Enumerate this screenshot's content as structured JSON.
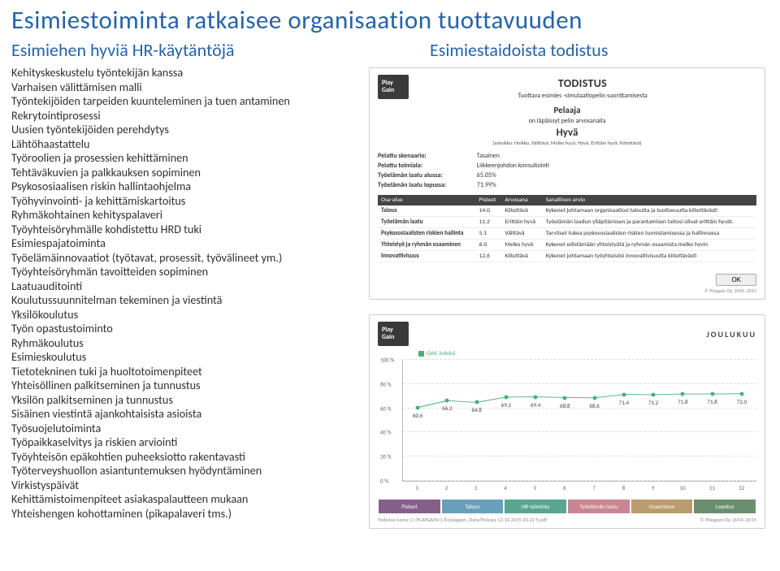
{
  "title": "Esimiestoiminta ratkaisee organisaation tuottavuuden",
  "left_heading": "Esimiehen hyviä HR-käytäntöjä",
  "right_heading": "Esimiestaidoista todistus",
  "practices": [
    "Kehityskeskustelu työntekijän kanssa",
    "Varhaisen välittämisen malli",
    "Työntekijöiden tarpeiden kuunteleminen ja tuen antaminen",
    "Rekrytointiprosessi",
    "Uusien työntekijöiden perehdytys",
    "Lähtöhaastattelu",
    "Työroolien ja prosessien kehittäminen",
    "Tehtäväkuvien ja palkkauksen sopiminen",
    "Psykososiaalisen riskin hallintaohjelma",
    "Työhyvinvointi- ja kehittämiskartoitus",
    "Ryhmäkohtainen kehityspalaveri",
    "Työyhteisöryhmälle kohdistettu HRD tuki",
    "Esimiespajatoiminta",
    "Työelämäinnovaatiot (työtavat, prosessit, työvälineet ym.)",
    "Työyhteisöryhmän tavoitteiden sopiminen",
    "Laatuauditointi",
    "Koulutussuunnitelman tekeminen ja viestintä",
    "Yksilökoulutus",
    "Työn opastustoiminto",
    "Ryhmäkoulutus",
    "Esimieskoulutus",
    "Tietotekninen tuki ja huoltotoimenpiteet",
    "Yhteisöllinen palkitseminen ja tunnustus",
    "Yksilön palkitseminen ja tunnustus",
    "Sisäinen viestintä ajankohtaisista asioista",
    "Työsuojelutoiminta",
    "Työpaikkaselvitys ja riskien arviointi",
    "Työyhteisön epäkohtien puheeksiotto rakentavasti",
    "Työterveyshuollon asiantuntemuksen hyödyntäminen",
    "Virkistyspäivät",
    "Kehittämistoimenpiteet asiakaspalautteen mukaan",
    "Yhteishengen kohottaminen (pikapalaveri tms.)"
  ],
  "cert": {
    "logo": "Play Gain",
    "title": "TODISTUS",
    "sub": "Tuottava esimies -simulaatiopelin suorittamisesta",
    "player": "Pelaaja",
    "passed": "on läpäissyt pelin arvosanalla",
    "grade": "Hyvä",
    "scale": "(asteikko: Heikko, Välttävä, Melko hyvä, Hyvä, Erittäin hyvä, Kiitettävä)",
    "meta": [
      {
        "k": "Pelattu skenaario:",
        "v": "Tasainen"
      },
      {
        "k": "Pelattu toimiala:",
        "v": "Liikkeenjohdon konsultointi"
      },
      {
        "k": "Työelämän laatu alussa:",
        "v": "65.05%"
      },
      {
        "k": "Työelämän laatu lopussa:",
        "v": "71.99%"
      }
    ],
    "th": [
      "Osa-alue",
      "Pisteet",
      "Arvosana",
      "Sanallinen arvio"
    ],
    "rows": [
      {
        "a": "Talous",
        "p": "14.0",
        "g": "Kiitettävä",
        "t": "Kykenet johtamaan organisaatiosi taloutta ja tuottavuutta kiitettävästi"
      },
      {
        "a": "Työelämän laatu",
        "p": "11.2",
        "g": "Erittäin hyvä",
        "t": "Työelämän laadun ylläpitämisen ja parantamisen taitosi olivat erittäin hyvät."
      },
      {
        "a": "Psykososiaalisten riskien hallinta",
        "p": "5.1",
        "g": "Välttävä",
        "t": "Tarvitset tukea psykososiaalisten riskien tunnistamisessa ja hallinnassa"
      },
      {
        "a": "Yhteistyö ja ryhmän osaaminen",
        "p": "6.0",
        "g": "Melko hyvä",
        "t": "Kykenet edistämään yhteistyötä ja ryhmän osaamista melko hyvin"
      },
      {
        "a": "Innovatiivisuus",
        "p": "12.6",
        "g": "Kiitettävä",
        "t": "Kykenet johtamaan työyhteisösi innovatiivisuutta kiitettävästi"
      }
    ],
    "ok": "OK",
    "copy": "© Playgain Oy, 2014–2015"
  },
  "chart_data": {
    "type": "line",
    "title": "JOULUKUU",
    "legend": "QWL indeksi",
    "ylabel": "%",
    "ylim": [
      0,
      100
    ],
    "yticks": [
      "0 %",
      "20 %",
      "40 %",
      "60 %",
      "80 %",
      "100 %"
    ],
    "x": [
      "1",
      "2",
      "3",
      "4",
      "5",
      "6",
      "7",
      "8",
      "9",
      "10",
      "11",
      "12"
    ],
    "values": [
      60.6,
      66.2,
      64.8,
      69.2,
      69.4,
      68.8,
      68.6,
      71.4,
      71.2,
      71.8,
      71.8,
      72.0
    ],
    "tabs": [
      "Pisteet",
      "Talous",
      "HR-toiminta",
      "Työelämän laatu",
      "Osaaminen",
      "Lopetus"
    ],
    "footer_left": "Todistus luotu: C:/PLAYGAIN/1.8/playgain_Data/Pelaaja 12.10.2015 20.22 5.pdf",
    "footer_right": "© Playgain Oy, 2014–2015"
  }
}
